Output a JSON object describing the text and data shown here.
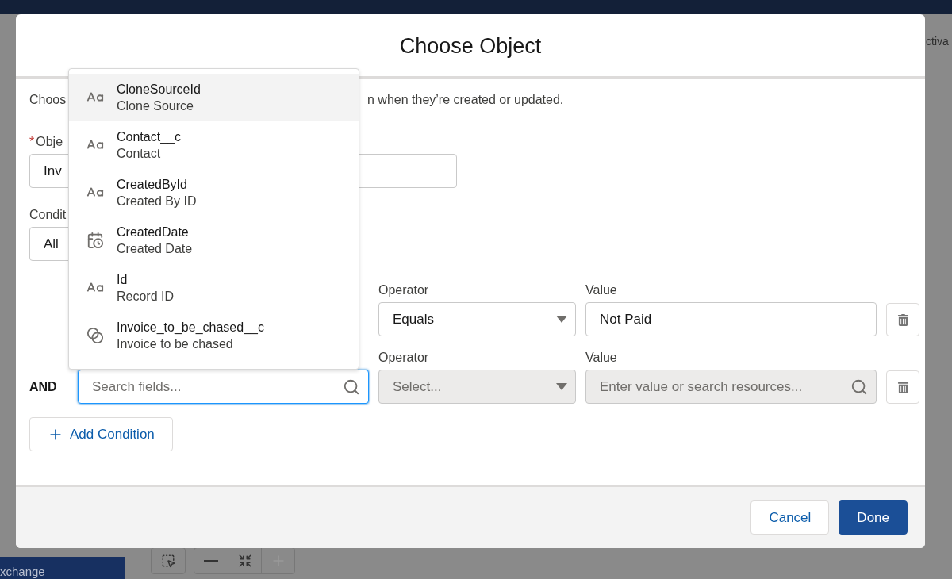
{
  "background": {
    "top_right_text": "ctiva",
    "bottom_left_tab": "xchange"
  },
  "modal": {
    "title": "Choose Object",
    "description": {
      "left": "Choos",
      "right": "n when they’re created or updated."
    },
    "object_field": {
      "label": "Obje",
      "required_mark": "*",
      "value": "Inv"
    },
    "conditions_field": {
      "label": "Condit",
      "value": "All"
    },
    "conditions": [
      {
        "operator_label": "Operator",
        "operator": "Equals",
        "value_label": "Value",
        "value": "Not Paid",
        "disabled": false
      },
      {
        "logic": "AND",
        "field": {
          "placeholder": "Search fields...",
          "focused": true
        },
        "operator_label": "Operator",
        "operator_placeholder": "Select...",
        "value_label": "Value",
        "value_placeholder": "Enter value or search resources...",
        "disabled": true
      }
    ],
    "add_condition": "Add Condition",
    "field_dropdown": {
      "items": [
        {
          "name": "CloneSourceId",
          "label": "Clone Source",
          "kind": "text",
          "selected": true
        },
        {
          "name": "Contact__c",
          "label": "Contact",
          "kind": "text",
          "selected": false
        },
        {
          "name": "CreatedById",
          "label": "Created By ID",
          "kind": "text",
          "selected": false
        },
        {
          "name": "CreatedDate",
          "label": "Created Date",
          "kind": "date",
          "selected": false
        },
        {
          "name": "Id",
          "label": "Record ID",
          "kind": "text",
          "selected": false
        },
        {
          "name": "Invoice_to_be_chased__c",
          "label": "Invoice to be chased",
          "kind": "boolean",
          "selected": false
        }
      ]
    },
    "buttons": [
      {
        "label": "Cancel",
        "kind": "secondary"
      },
      {
        "label": "Done",
        "kind": "primary"
      }
    ]
  }
}
